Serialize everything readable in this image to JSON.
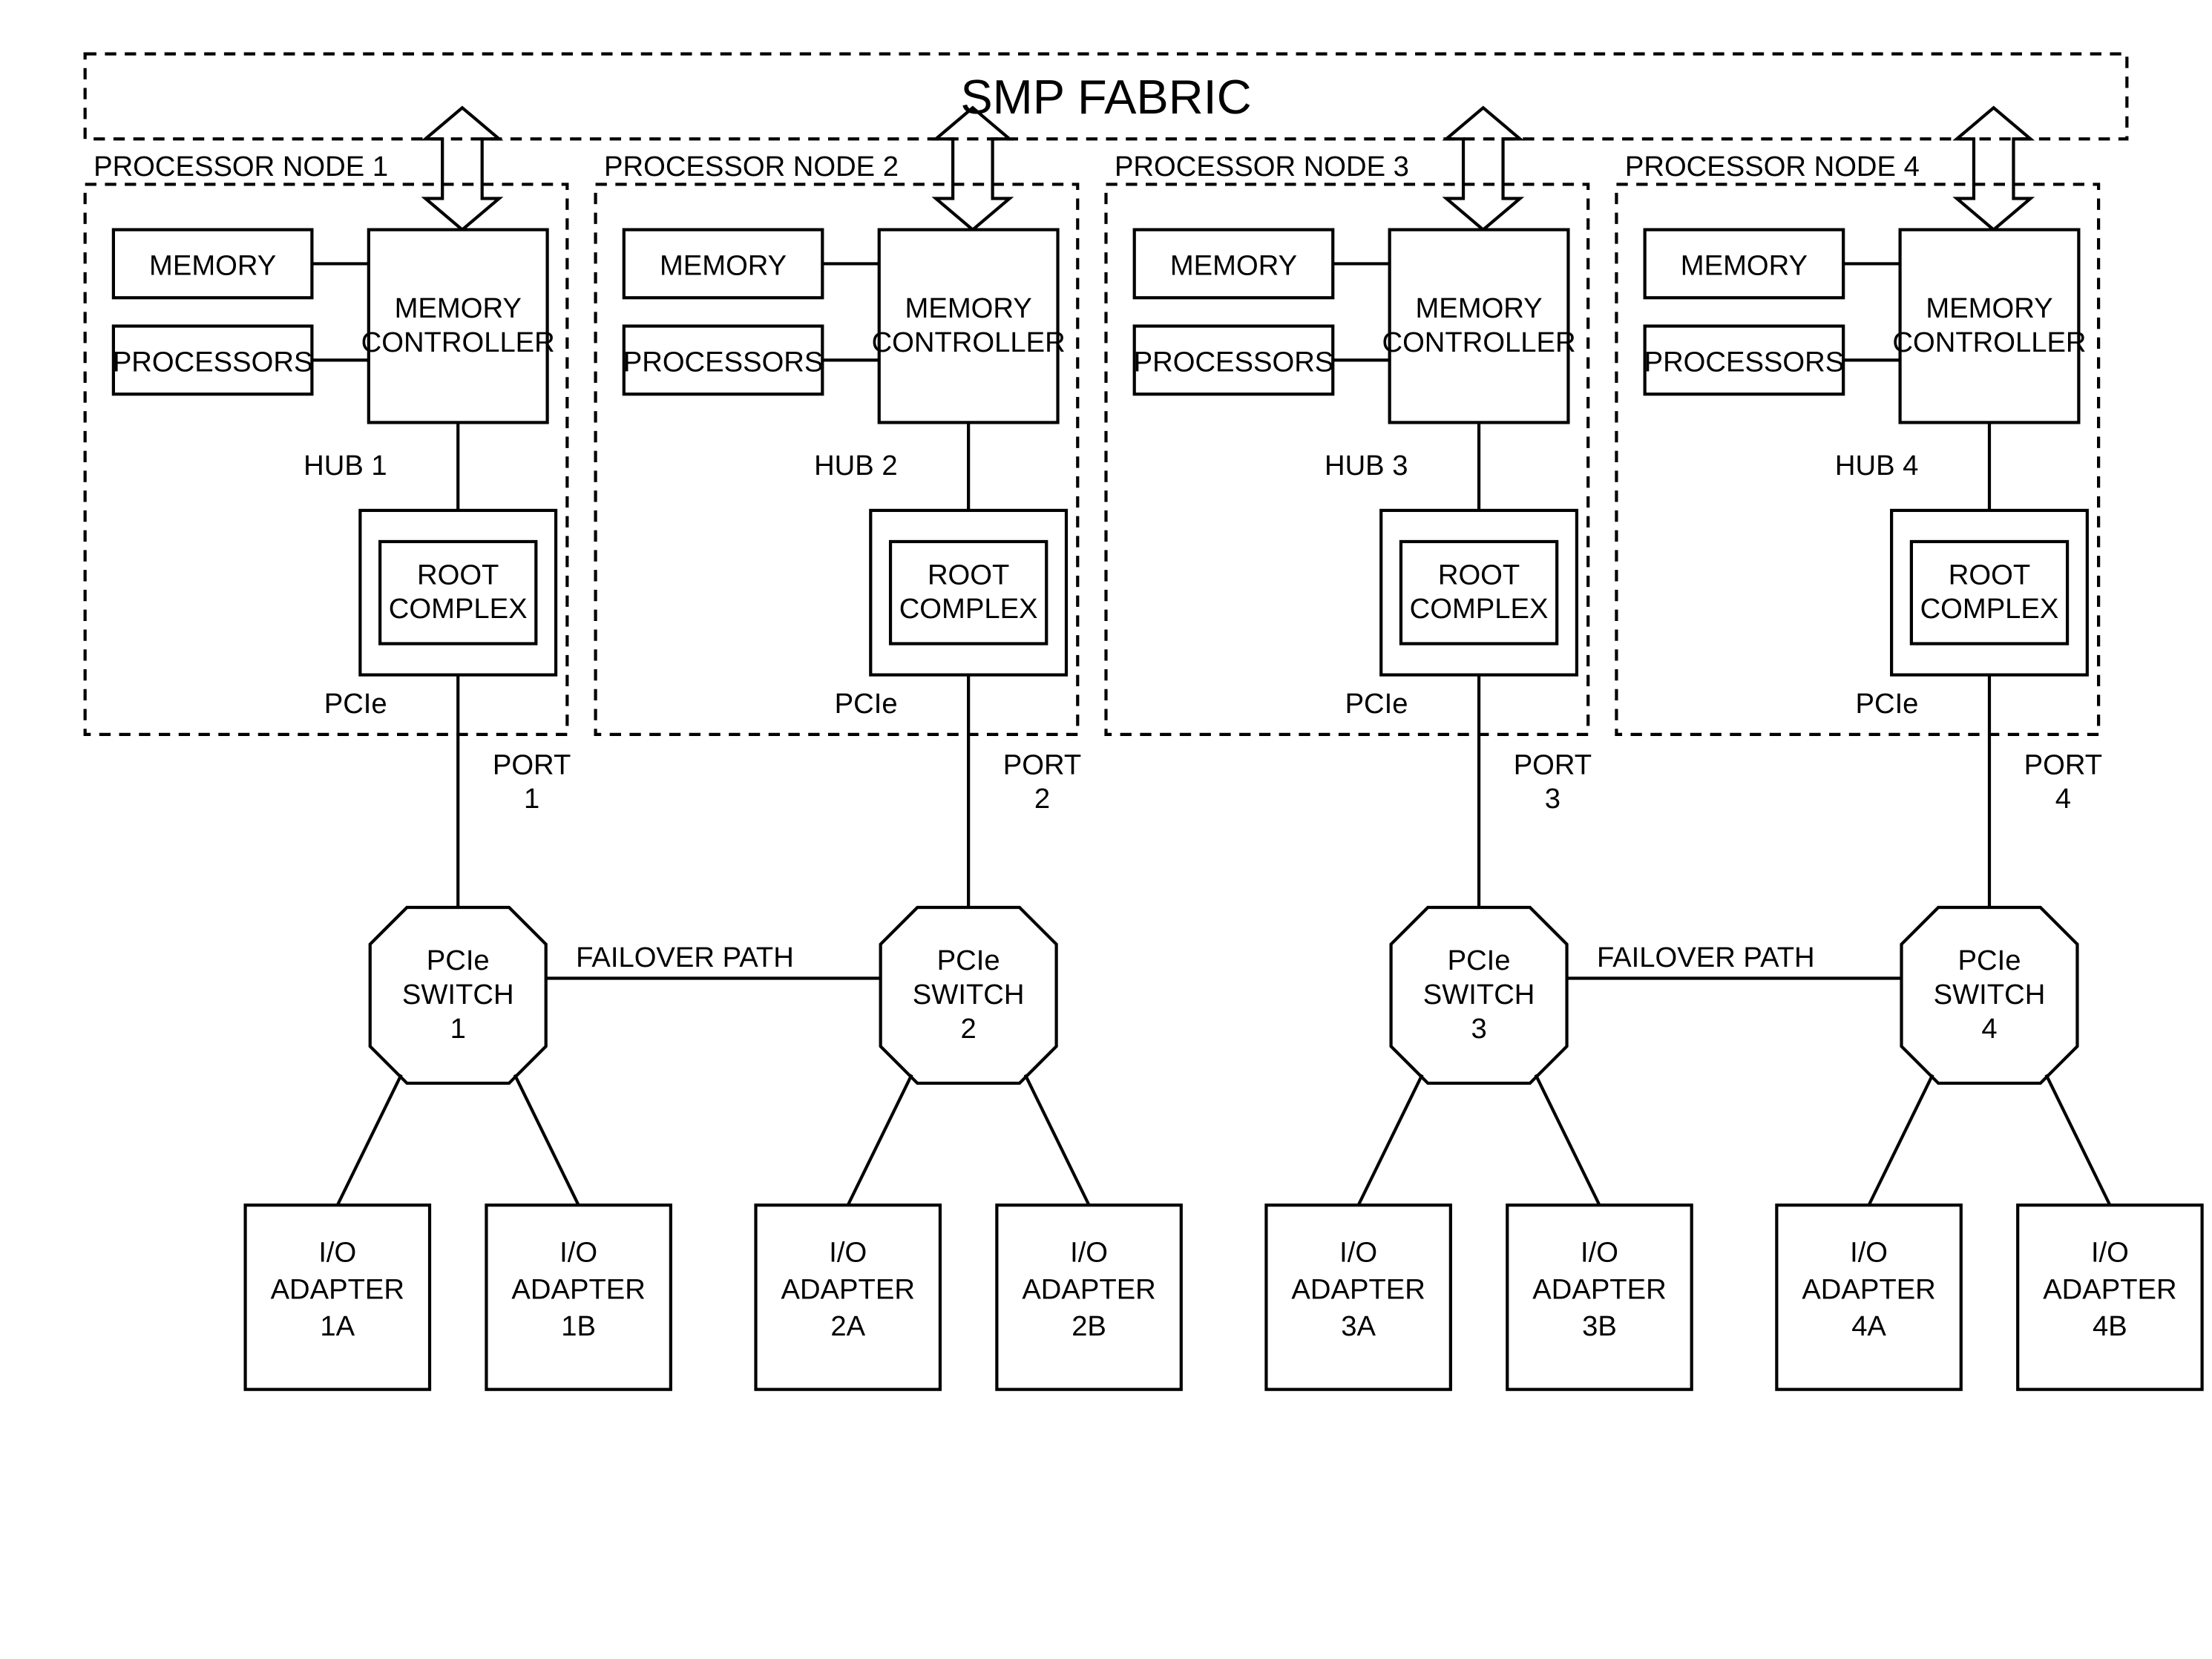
{
  "fabric": {
    "title": "SMP FABRIC"
  },
  "nodes": [
    {
      "title": "PROCESSOR NODE 1",
      "memory": "MEMORY",
      "processors": "PROCESSORS",
      "memctrl1": "MEMORY",
      "memctrl2": "CONTROLLER",
      "hub": "HUB 1",
      "root1": "ROOT",
      "root2": "COMPLEX",
      "pcie": "PCIe",
      "port1": "PORT",
      "port2": "1",
      "switch1": "PCIe",
      "switch2": "SWITCH",
      "switch3": "1",
      "ioA1": "I/O",
      "ioA2": "ADAPTER",
      "ioA3": "1A",
      "ioB1": "I/O",
      "ioB2": "ADAPTER",
      "ioB3": "1B"
    },
    {
      "title": "PROCESSOR NODE 2",
      "memory": "MEMORY",
      "processors": "PROCESSORS",
      "memctrl1": "MEMORY",
      "memctrl2": "CONTROLLER",
      "hub": "HUB 2",
      "root1": "ROOT",
      "root2": "COMPLEX",
      "pcie": "PCIe",
      "port1": "PORT",
      "port2": "2",
      "switch1": "PCIe",
      "switch2": "SWITCH",
      "switch3": "2",
      "ioA1": "I/O",
      "ioA2": "ADAPTER",
      "ioA3": "2A",
      "ioB1": "I/O",
      "ioB2": "ADAPTER",
      "ioB3": "2B"
    },
    {
      "title": "PROCESSOR NODE 3",
      "memory": "MEMORY",
      "processors": "PROCESSORS",
      "memctrl1": "MEMORY",
      "memctrl2": "CONTROLLER",
      "hub": "HUB 3",
      "root1": "ROOT",
      "root2": "COMPLEX",
      "pcie": "PCIe",
      "port1": "PORT",
      "port2": "3",
      "switch1": "PCIe",
      "switch2": "SWITCH",
      "switch3": "3",
      "ioA1": "I/O",
      "ioA2": "ADAPTER",
      "ioA3": "3A",
      "ioB1": "I/O",
      "ioB2": "ADAPTER",
      "ioB3": "3B"
    },
    {
      "title": "PROCESSOR NODE 4",
      "memory": "MEMORY",
      "processors": "PROCESSORS",
      "memctrl1": "MEMORY",
      "memctrl2": "CONTROLLER",
      "hub": "HUB 4",
      "root1": "ROOT",
      "root2": "COMPLEX",
      "pcie": "PCIe",
      "port1": "PORT",
      "port2": "4",
      "switch1": "PCIe",
      "switch2": "SWITCH",
      "switch3": "4",
      "ioA1": "I/O",
      "ioA2": "ADAPTER",
      "ioA3": "4A",
      "ioB1": "I/O",
      "ioB2": "ADAPTER",
      "ioB3": "4B"
    }
  ],
  "failover": {
    "label12": "FAILOVER PATH",
    "label34": "FAILOVER PATH"
  }
}
